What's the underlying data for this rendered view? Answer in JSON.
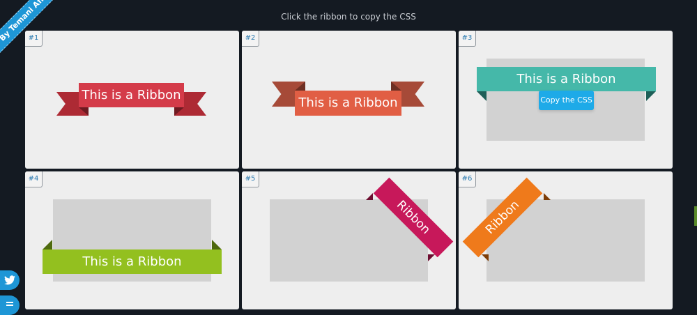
{
  "page": {
    "author_badge": "By Temani Afif",
    "hint": "Click the ribbon to copy the CSS"
  },
  "colors": {
    "background": "#141a22",
    "card": "#eeeeee",
    "ribbon_1": "#d43b49",
    "ribbon_2": "#e15e44",
    "ribbon_3": "#45b8a9",
    "ribbon_4": "#93c01f",
    "ribbon_5": "#c7185a",
    "ribbon_6": "#ef7a1b",
    "copy_button": "#1eaae8"
  },
  "cards": [
    {
      "num": "#1",
      "ribbon": "This is a Ribbon"
    },
    {
      "num": "#2",
      "ribbon": "This is a Ribbon"
    },
    {
      "num": "#3",
      "ribbon": "This is a Ribbon",
      "copy_button": "Copy the CSS"
    },
    {
      "num": "#4",
      "ribbon": "This is a Ribbon"
    },
    {
      "num": "#5",
      "ribbon": "Ribbon"
    },
    {
      "num": "#6",
      "ribbon": "Ribbon"
    }
  ],
  "social": [
    {
      "icon": "twitter-icon"
    },
    {
      "icon": "codepen-icon"
    }
  ]
}
